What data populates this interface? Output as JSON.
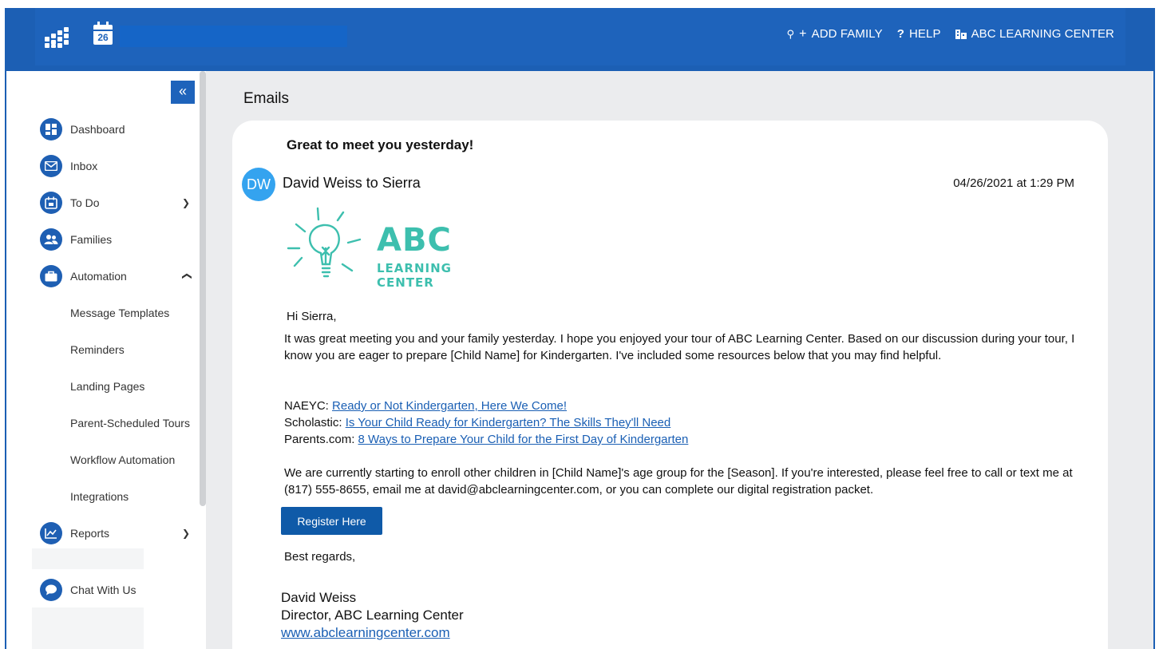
{
  "header": {
    "calendar_day": "26",
    "search_value": "",
    "add_family_label": "ADD FAMILY",
    "help_label": "HELP",
    "org_name": "ABC LEARNING CENTER",
    "colors": {
      "bar": "#1c5fb4",
      "accent": "#1e63bb"
    }
  },
  "sidebar": {
    "collapse_glyph": "«",
    "items": [
      {
        "label": "Dashboard",
        "icon": "dashboard-icon"
      },
      {
        "label": "Inbox",
        "icon": "mail-icon"
      },
      {
        "label": "To Do",
        "icon": "calendar-icon",
        "chevron": "down"
      },
      {
        "label": "Families",
        "icon": "people-icon"
      },
      {
        "label": "Automation",
        "icon": "briefcase-icon",
        "chevron": "up"
      }
    ],
    "automation_sub": [
      "Message Templates",
      "Reminders",
      "Landing Pages",
      "Parent-Scheduled Tours",
      "Workflow Automation",
      "Integrations"
    ],
    "reports": {
      "label": "Reports",
      "icon": "chart-icon",
      "chevron": "down"
    },
    "chat_label": "Chat With Us"
  },
  "main": {
    "page_title": "Emails",
    "email": {
      "subject": "Great to meet you yesterday!",
      "avatar_initials": "DW",
      "from_line": "David Weiss to Sierra",
      "sent_at": "04/26/2021 at 1:29 PM",
      "logo": {
        "line1": "ABC",
        "line2": "LEARNING CENTER",
        "color": "#3dbfae"
      },
      "greeting": "Hi Sierra,",
      "intro": "It was great meeting you and your family yesterday. I hope you enjoyed your tour of  ABC Learning Center. Based on our discussion during your tour, I know you are eager to prepare [Child Name] for Kindergarten. I've included some resources below that you may find helpful.",
      "resources": [
        {
          "source": "NAEYC: ",
          "title": "Ready or Not Kindergarten, Here We Come! "
        },
        {
          "source": "Scholastic: ",
          "title": "Is Your Child Ready for Kindergarten? The Skills They'll Need "
        },
        {
          "source": "Parents.com: ",
          "title": "8 Ways to Prepare Your Child for the First Day of Kindergarten"
        }
      ],
      "enroll_text": "We are currently starting to enroll other children in [Child Name]'s age group for the [Season]. If you're interested, please feel free to call or text me at (817) 555-8655, email me at david@abclearningcenter.com, or you can complete our digital registration packet.",
      "register_button": "Register Here",
      "closing": "Best regards,",
      "signature_name": "David Weiss",
      "signature_title": "Director, ABC Learning Center",
      "signature_link": "www.abclearningcenter.com"
    }
  }
}
